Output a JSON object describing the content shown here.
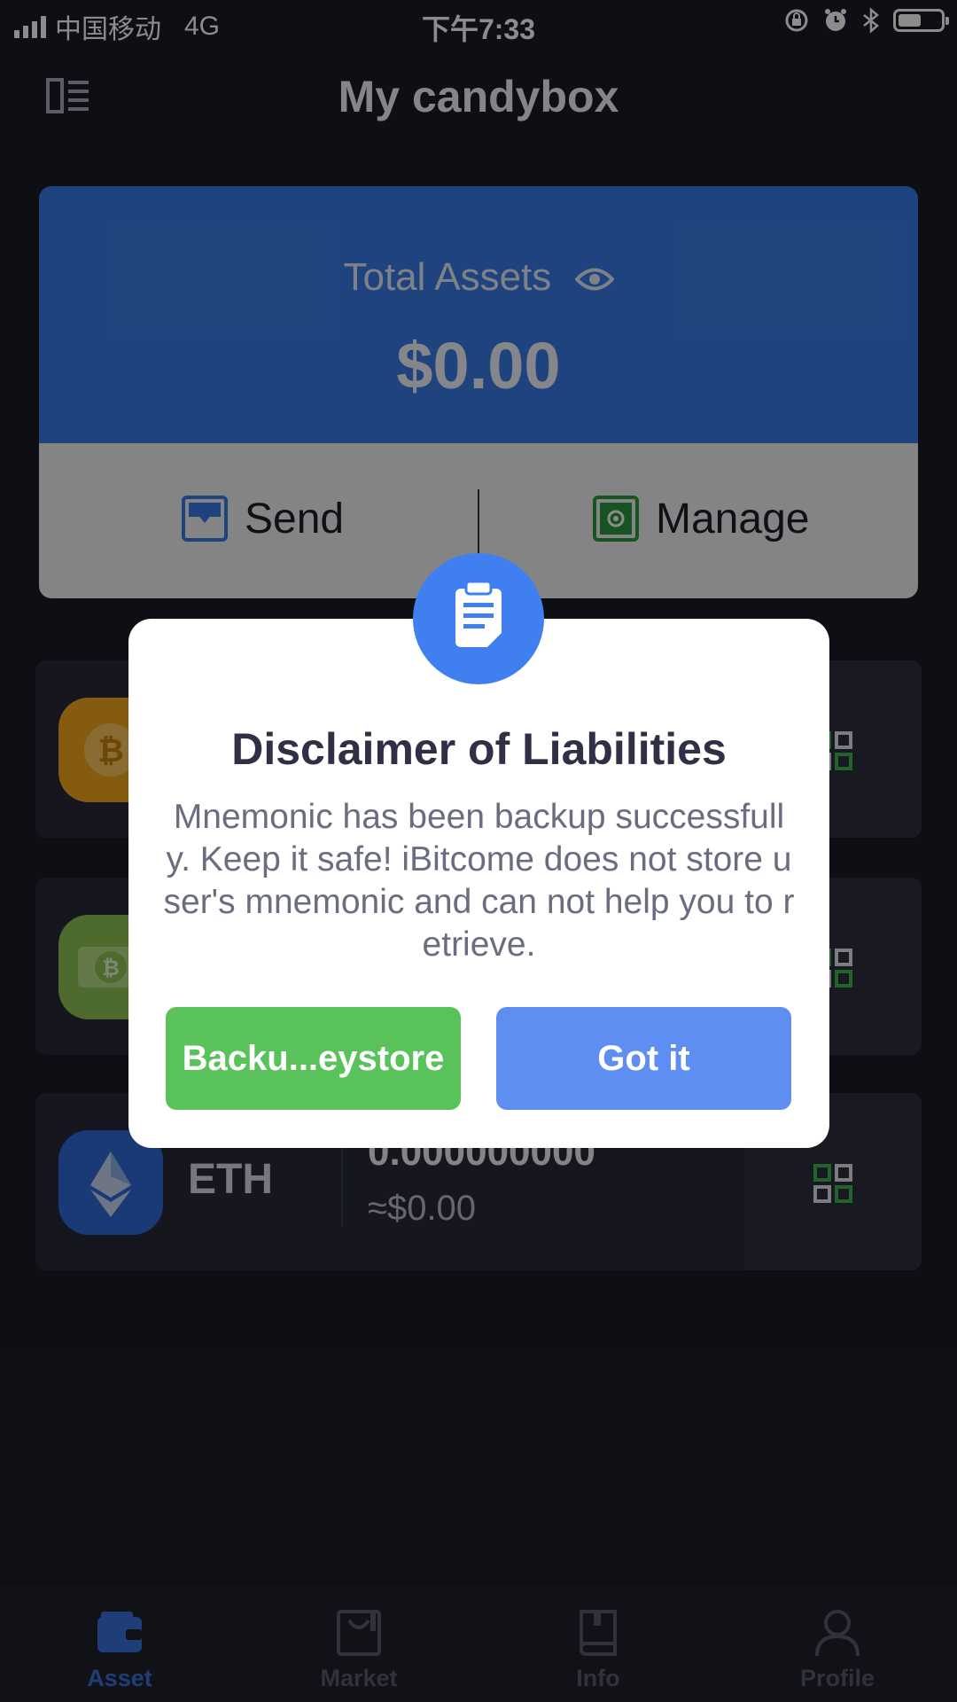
{
  "status_bar": {
    "carrier": "中国移动",
    "network": "4G",
    "time": "下午7:33",
    "battery_level": 0.55
  },
  "header": {
    "title": "My candybox",
    "menu_icon": "sidebar-menu-icon"
  },
  "total_card": {
    "label": "Total Assets",
    "value": "$0.00",
    "visibility_icon": "eye-icon",
    "send_label": "Send",
    "manage_label": "Manage"
  },
  "coins": [
    {
      "name": "",
      "amount": "",
      "fiat": "",
      "icon": "bitcoin-icon",
      "color": "#f2a81d"
    },
    {
      "name": "",
      "amount": "",
      "fiat": "",
      "icon": "bitcoin-cash-icon",
      "color": "#8dc351"
    },
    {
      "name": "ETH",
      "amount": "0.000000000",
      "fiat": "≈$0.00",
      "icon": "ethereum-icon",
      "color": "#2f6bd8"
    }
  ],
  "dialog": {
    "title": "Disclaimer of Liabilities",
    "message": "Mnemonic has been backup successfully. Keep it safe! iBitcome does not store user's mnemonic and can not help you to retrieve.",
    "backup_label": "Backu...eystore",
    "gotit_label": "Got it",
    "icon": "clipboard-icon"
  },
  "tabs": [
    {
      "label": "Asset",
      "icon": "wallet-icon",
      "active": true
    },
    {
      "label": "Market",
      "icon": "market-bag-icon",
      "active": false
    },
    {
      "label": "Info",
      "icon": "book-icon",
      "active": false
    },
    {
      "label": "Profile",
      "icon": "person-icon",
      "active": false
    }
  ],
  "colors": {
    "accent_blue": "#3a7be6",
    "backup_green": "#5ac25a",
    "gotit_blue": "#5f8ef3",
    "background": "#1b1c26"
  }
}
